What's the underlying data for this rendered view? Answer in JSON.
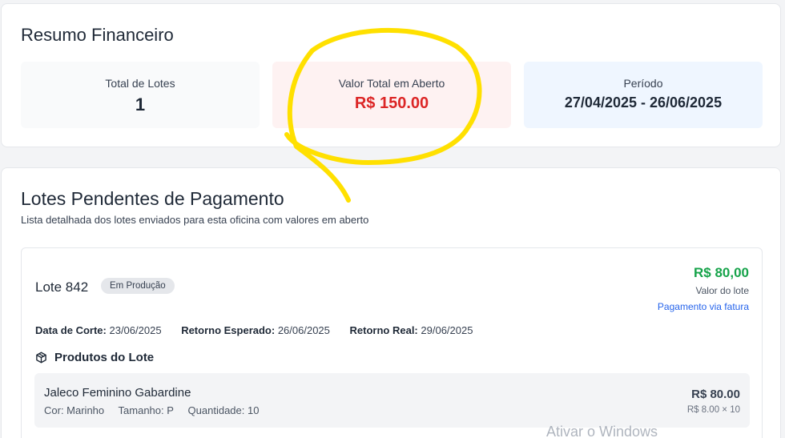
{
  "summary": {
    "title": "Resumo Financeiro",
    "total_lotes_label": "Total de Lotes",
    "total_lotes_value": "1",
    "valor_aberto_label": "Valor Total em Aberto",
    "valor_aberto_value": "R$ 150.00",
    "periodo_label": "Período",
    "periodo_value": "27/04/2025 - 26/06/2025"
  },
  "pending": {
    "title": "Lotes Pendentes de Pagamento",
    "subtitle": "Lista detalhada dos lotes enviados para esta oficina com valores em aberto",
    "lots": [
      {
        "title": "Lote 842",
        "status": "Em Produção",
        "price": "R$ 80,00",
        "price_label": "Valor do lote",
        "pay_link": "Pagamento via fatura",
        "corte_label": "Data de Corte:",
        "corte_value": "23/06/2025",
        "retorno_esp_label": "Retorno Esperado:",
        "retorno_esp_value": "26/06/2025",
        "retorno_real_label": "Retorno Real:",
        "retorno_real_value": "29/06/2025",
        "products_title": "Produtos do Lote",
        "products": [
          {
            "name": "Jaleco Feminino Gabardine",
            "cor": "Cor: Marinho",
            "tamanho": "Tamanho: P",
            "quantidade": "Quantidade: 10",
            "total": "R$ 80.00",
            "unit": "R$ 8.00 × 10"
          }
        ]
      }
    ]
  },
  "watermark": "Ativar o Windows",
  "colors": {
    "open_value": "#dc2626",
    "lot_price": "#16a34a",
    "link": "#2563eb",
    "highlight": "#ffe000"
  },
  "icons": {
    "products": "box-icon"
  }
}
